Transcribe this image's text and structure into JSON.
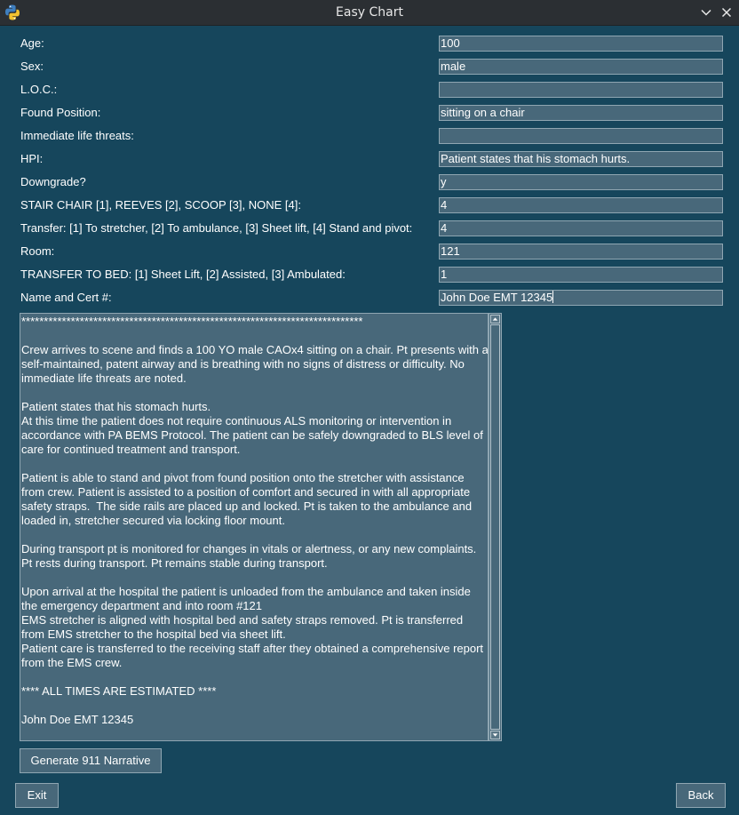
{
  "window": {
    "title": "Easy Chart",
    "app_icon": "python-logo-icon",
    "controls": [
      "minimize-chevron-icon",
      "close-icon"
    ]
  },
  "fields": [
    {
      "label": "Age:",
      "value": "100"
    },
    {
      "label": "Sex:",
      "value": "male"
    },
    {
      "label": "L.O.C.:",
      "value": ""
    },
    {
      "label": "Found Position:",
      "value": "sitting on a chair"
    },
    {
      "label": "Immediate life threats:",
      "value": ""
    },
    {
      "label": "HPI:",
      "value": "Patient states that his stomach hurts."
    },
    {
      "label": "Downgrade?",
      "value": "y"
    },
    {
      "label": "STAIR CHAIR [1], REEVES [2], SCOOP [3], NONE [4]:",
      "value": "4"
    },
    {
      "label": "Transfer: [1] To stretcher, [2] To ambulance, [3] Sheet lift, [4] Stand and pivot:",
      "value": "4"
    },
    {
      "label": "Room:",
      "value": "121"
    },
    {
      "label": "TRANSFER TO BED: [1] Sheet Lift, [2] Assisted, [3] Ambulated:",
      "value": "1"
    },
    {
      "label": "Name and Cert #:",
      "value": "John Doe EMT 12345"
    }
  ],
  "narrative": "****************************************************************************\n\nCrew arrives to scene and finds a 100 YO male CAOx4 sitting on a chair. Pt presents with a self-maintained, patent airway and is breathing with no signs of distress or difficulty. No immediate life threats are noted.\n\nPatient states that his stomach hurts.\nAt this time the patient does not require continuous ALS monitoring or intervention in accordance with PA BEMS Protocol. The patient can be safely downgraded to BLS level of care for continued treatment and transport.\n\nPatient is able to stand and pivot from found position onto the stretcher with assistance from crew. Patient is assisted to a position of comfort and secured in with all appropriate safety straps.  The side rails are placed up and locked. Pt is taken to the ambulance and loaded in, stretcher secured via locking floor mount.\n\nDuring transport pt is monitored for changes in vitals or alertness, or any new complaints. Pt rests during transport. Pt remains stable during transport.\n\nUpon arrival at the hospital the patient is unloaded from the ambulance and taken inside the emergency department and into room #121\nEMS stretcher is aligned with hospital bed and safety straps removed. Pt is transferred from EMS stretcher to the hospital bed via sheet lift.\nPatient care is transferred to the receiving staff after they obtained a comprehensive report from the EMS crew.\n\n**** ALL TIMES ARE ESTIMATED ****\n\nJohn Doe EMT 12345",
  "buttons": {
    "generate": "Generate 911 Narrative",
    "exit": "Exit",
    "back": "Back"
  },
  "colors": {
    "background": "#16465c",
    "field_bg": "#48687a",
    "titlebar": "#2b2f33"
  }
}
